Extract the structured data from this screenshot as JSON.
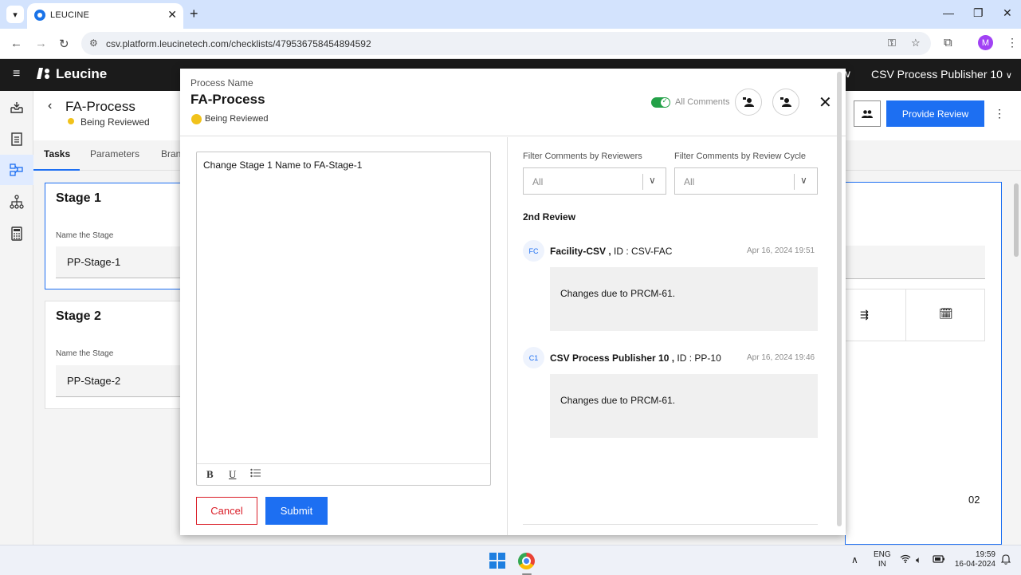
{
  "browser": {
    "tab_title": "LEUCINE",
    "url": "csv.platform.leucinetech.com/checklists/479536758454894592",
    "profile_initial": "M"
  },
  "app": {
    "logo_text": "Leucine",
    "user_name": "CSV Process Publisher 10"
  },
  "background_page": {
    "title": "FA-Process",
    "status": "Being Reviewed",
    "tabs": [
      "Tasks",
      "Parameters",
      "Bran"
    ],
    "provide_review_label": "Provide Review",
    "stages": [
      {
        "title": "Stage 1",
        "field_label": "Name the Stage",
        "value": "PP-Stage-1"
      },
      {
        "title": "Stage 2",
        "field_label": "Name the Stage",
        "value": "PP-Stage-2"
      }
    ],
    "page_number": "02"
  },
  "modal": {
    "label": "Process Name",
    "title": "FA-Process",
    "status": "Being Reviewed",
    "toggle_label": "All Comments",
    "toggle_on": true,
    "editor_text": "Change Stage 1 Name to FA-Stage-1",
    "toolbar": {
      "bold": "B",
      "underline": "U"
    },
    "cancel_label": "Cancel",
    "submit_label": "Submit",
    "filters": [
      {
        "label": "Filter Comments by Reviewers",
        "value": "All"
      },
      {
        "label": "Filter Comments by Review Cycle",
        "value": "All"
      }
    ],
    "review_heading": "2nd Review",
    "comments": [
      {
        "initials": "FC",
        "name": "Facility-CSV ,",
        "id_text": "ID : CSV-FAC",
        "date": "Apr 16, 2024 19:51",
        "text": "Changes due to PRCM-61."
      },
      {
        "initials": "C1",
        "name": "CSV Process Publisher 10 ,",
        "id_text": "ID : PP-10",
        "date": "Apr 16, 2024 19:46",
        "text": "Changes due to PRCM-61."
      }
    ]
  },
  "taskbar": {
    "lang_top": "ENG",
    "lang_bottom": "IN",
    "time": "19:59",
    "date": "16-04-2024"
  },
  "colors": {
    "primary": "#1d6ff2",
    "status_yellow": "#f1c21b",
    "toggle_green": "#24a148",
    "cancel_red": "#da1e28",
    "header_dark": "#1b1b1b"
  }
}
